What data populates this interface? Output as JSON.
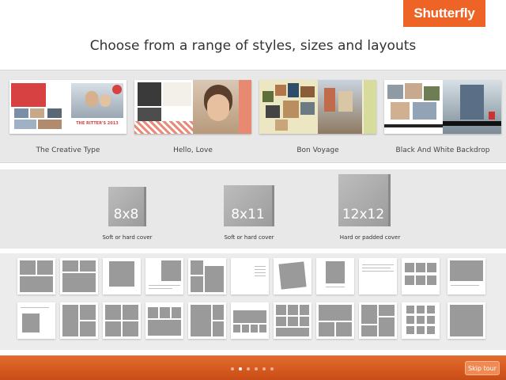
{
  "brand": {
    "logo_text": "Shutterfly",
    "accent": "#ee6426"
  },
  "headline": "Choose from a range of styles, sizes and layouts",
  "styles": [
    {
      "label": "The Creative Type"
    },
    {
      "label": "Hello, Love"
    },
    {
      "label": "Bon Voyage"
    },
    {
      "label": "Black And White Backdrop"
    }
  ],
  "creative_type_cover_text": "THE RITTER'S 2013",
  "sizes": [
    {
      "label": "8x8",
      "caption": "Soft or hard cover"
    },
    {
      "label": "8x11",
      "caption": "Soft or hard cover"
    },
    {
      "label": "12x12",
      "caption": "Hard or padded cover"
    }
  ],
  "pagination": {
    "count": 6,
    "active": 1
  },
  "skip_label": "Skip tour"
}
